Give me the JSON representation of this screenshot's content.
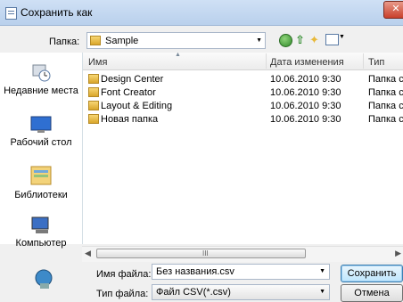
{
  "window": {
    "title": "Сохранить как",
    "close_label": "✕"
  },
  "toolbar": {
    "folder_label": "Папка:",
    "folder_value": "Sample"
  },
  "nav": {
    "items": [
      {
        "label": "Недавние места",
        "icon": "recent-places-icon"
      },
      {
        "label": "Рабочий стол",
        "icon": "desktop-icon"
      },
      {
        "label": "Библиотеки",
        "icon": "libraries-icon"
      },
      {
        "label": "Компьютер",
        "icon": "computer-icon"
      },
      {
        "label": "",
        "icon": "network-icon"
      }
    ]
  },
  "filelist": {
    "columns": [
      "Имя",
      "Дата изменения",
      "Тип"
    ],
    "rows": [
      {
        "name": "Design Center",
        "date": "10.06.2010 9:30",
        "type": "Папка с"
      },
      {
        "name": "Font Creator",
        "date": "10.06.2010 9:30",
        "type": "Папка с"
      },
      {
        "name": "Layout & Editing",
        "date": "10.06.2010 9:30",
        "type": "Папка с"
      },
      {
        "name": "Новая папка",
        "date": "10.06.2010 9:30",
        "type": "Папка с"
      }
    ],
    "scroll_grip": "III"
  },
  "form": {
    "filename_label": "Имя файла:",
    "filename_value": "Без названия.csv",
    "filetype_label": "Тип файла:",
    "filetype_value": "Файл CSV(*.csv)"
  },
  "buttons": {
    "save": "Сохранить",
    "cancel": "Отмена"
  }
}
